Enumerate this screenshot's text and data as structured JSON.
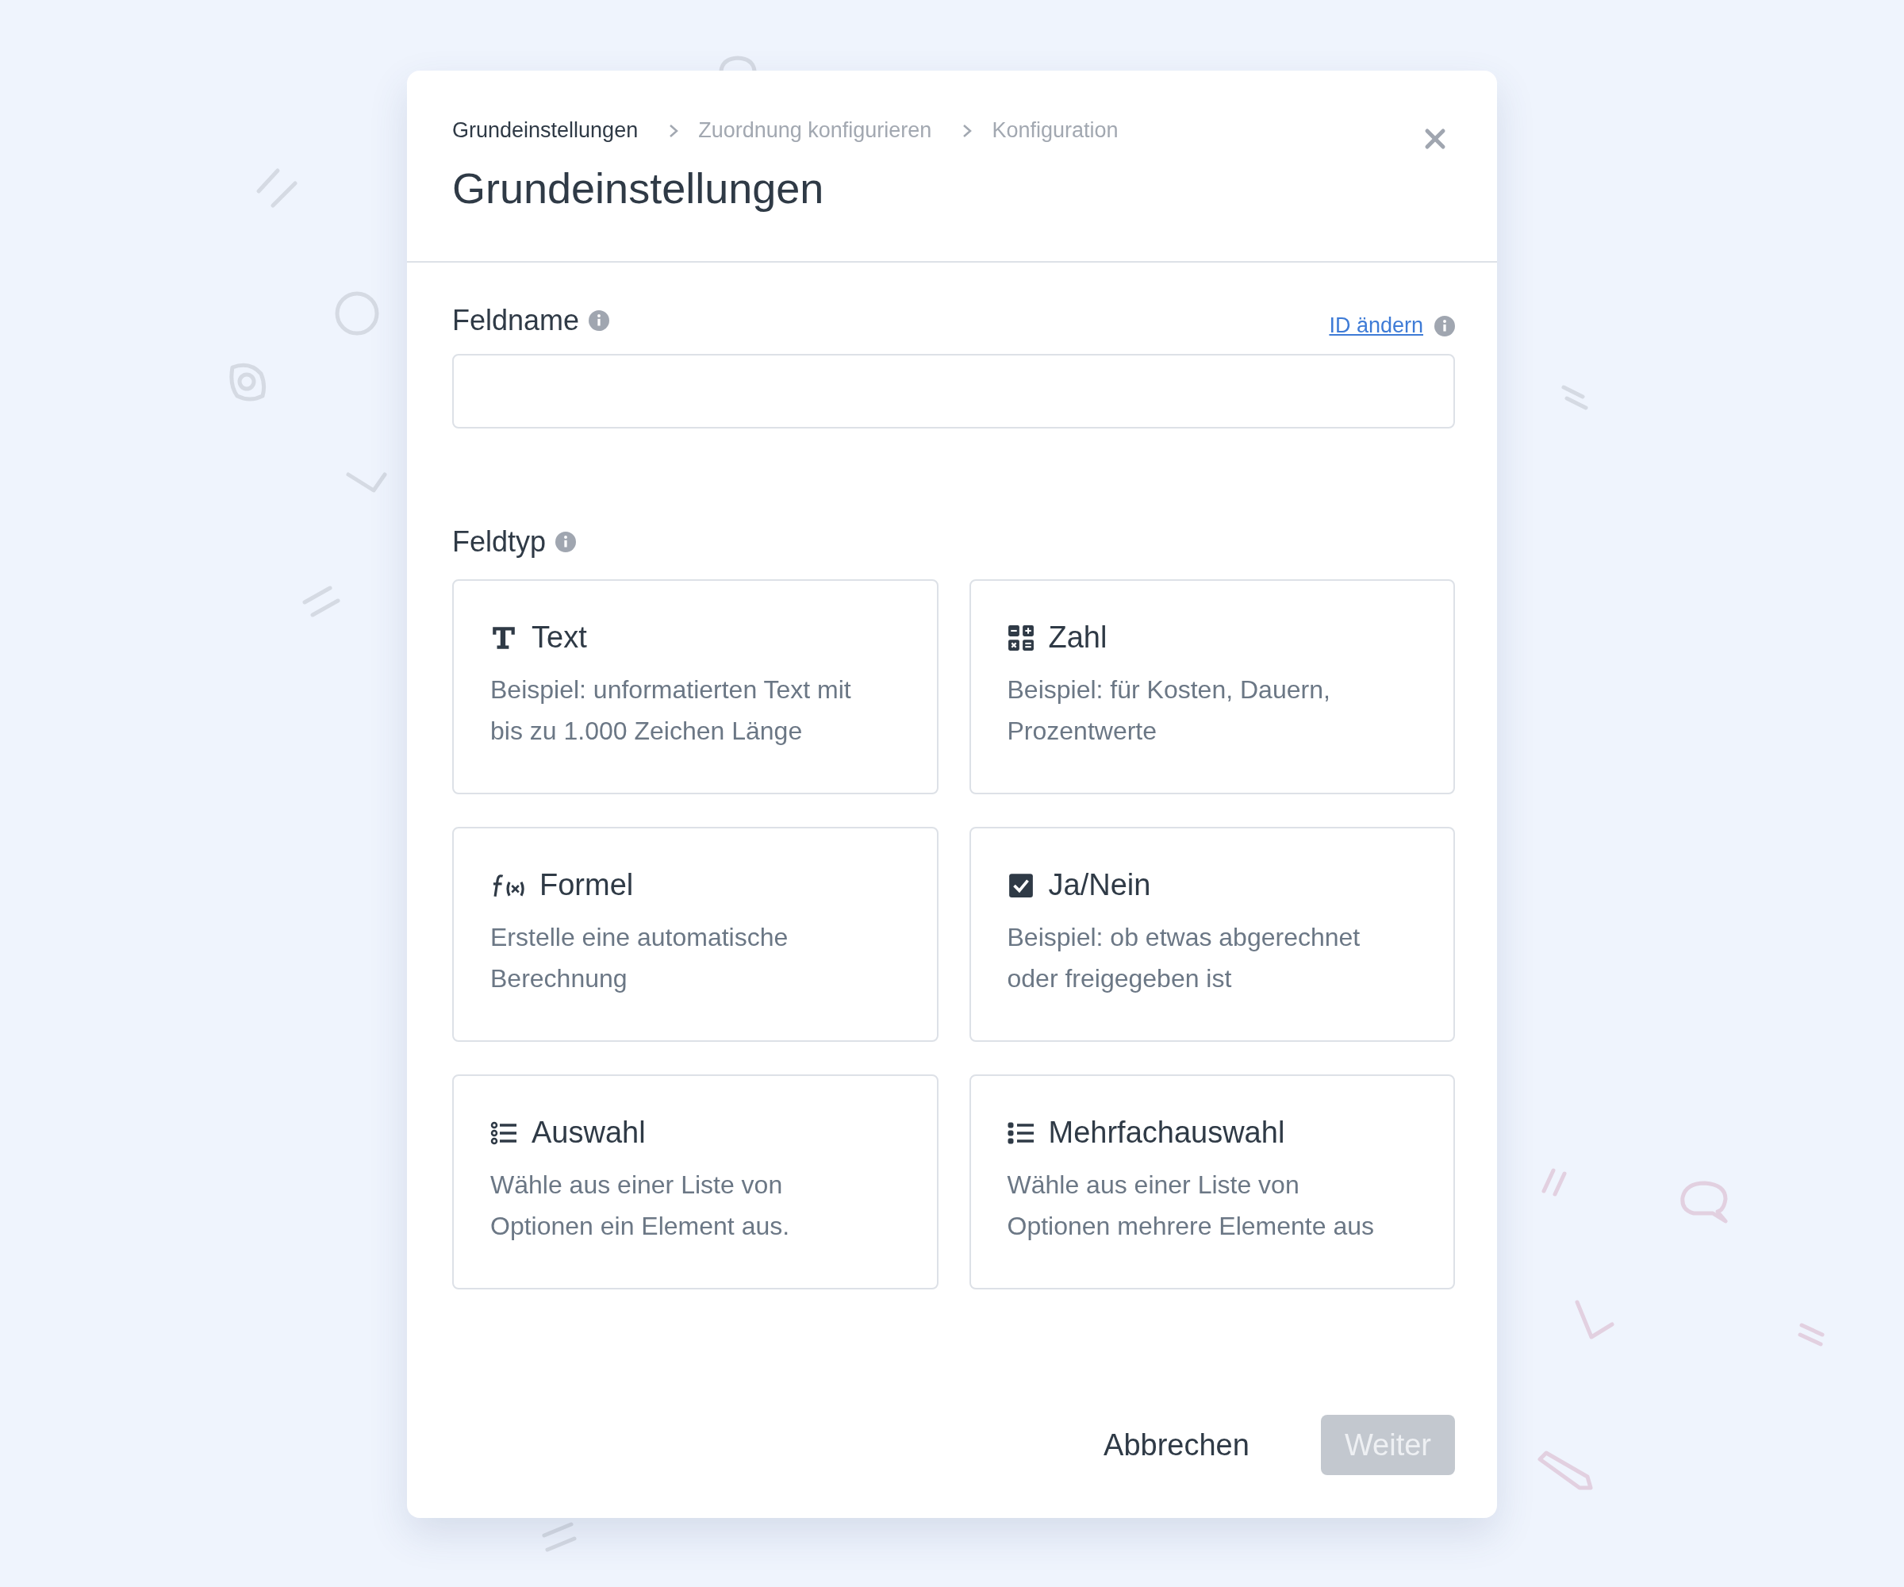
{
  "breadcrumb": [
    {
      "label": "Grundeinstellungen",
      "selected": true
    },
    {
      "label": "Zuordnung konfigurieren",
      "selected": false
    },
    {
      "label": "Konfiguration",
      "selected": false
    }
  ],
  "title": "Grundeinstellungen",
  "field_name": {
    "label": "Feldname",
    "link": "ID ändern"
  },
  "field_type": {
    "label": "Feldtyp",
    "options": [
      {
        "kind": "text",
        "title": "Text",
        "description": "Beispiel: unformatierten Text mit bis zu 1.000 Zeichen Länge"
      },
      {
        "kind": "number",
        "title": "Zahl",
        "description": "Beispiel: für Kosten, Dauern, Prozentwerte"
      },
      {
        "kind": "formula",
        "title": "Formel",
        "description": "Erstelle eine automatische Berechnung"
      },
      {
        "kind": "boolean",
        "title": "Ja/Nein",
        "description": "Beispiel: ob etwas abgerechnet oder freigegeben ist"
      },
      {
        "kind": "select",
        "title": "Auswahl",
        "description": "Wähle aus einer Liste von Optionen ein Element aus."
      },
      {
        "kind": "multiselect",
        "title": "Mehrfachauswahl",
        "description": "Wähle aus einer Liste von Optionen mehrere Elemente aus"
      }
    ]
  },
  "buttons": [
    {
      "label": "Abbrechen",
      "kind": "secondary",
      "disabled": false
    },
    {
      "label": "Weiter",
      "kind": "primary",
      "disabled": true
    }
  ]
}
